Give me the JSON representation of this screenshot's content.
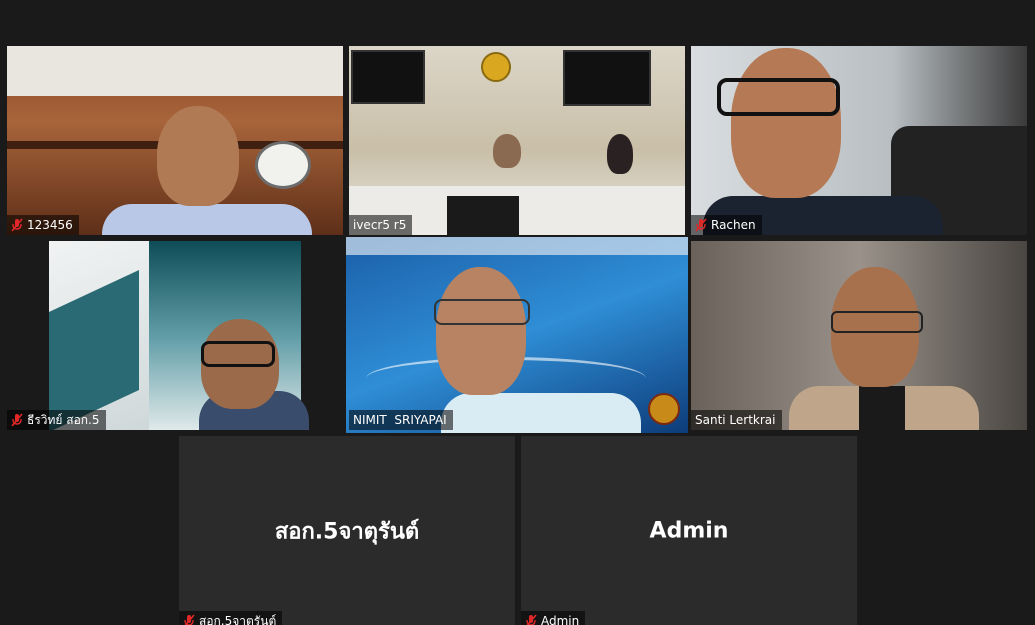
{
  "participants": [
    {
      "name": "123456",
      "muted": true
    },
    {
      "name": "ivecr5 r5",
      "muted": false
    },
    {
      "name": "Rachen",
      "muted": true
    },
    {
      "name": "ธีรวิทย์ สอก.5",
      "muted": true
    },
    {
      "name": "NIMIT  SRIYAPAI",
      "muted": false,
      "active_speaker": true
    },
    {
      "name": "Santi Lertkrai",
      "muted": false
    },
    {
      "name": "สอก.5จาตุรันต์",
      "muted": true,
      "video_off": true,
      "display_name": "สอก.5จาตุรันต์"
    },
    {
      "name": "Admin",
      "muted": true,
      "video_off": true,
      "display_name": "Admin"
    }
  ],
  "colors": {
    "active_outline": "#c8e35a",
    "mute_red": "#e02828",
    "background": "#1a1a1a"
  }
}
